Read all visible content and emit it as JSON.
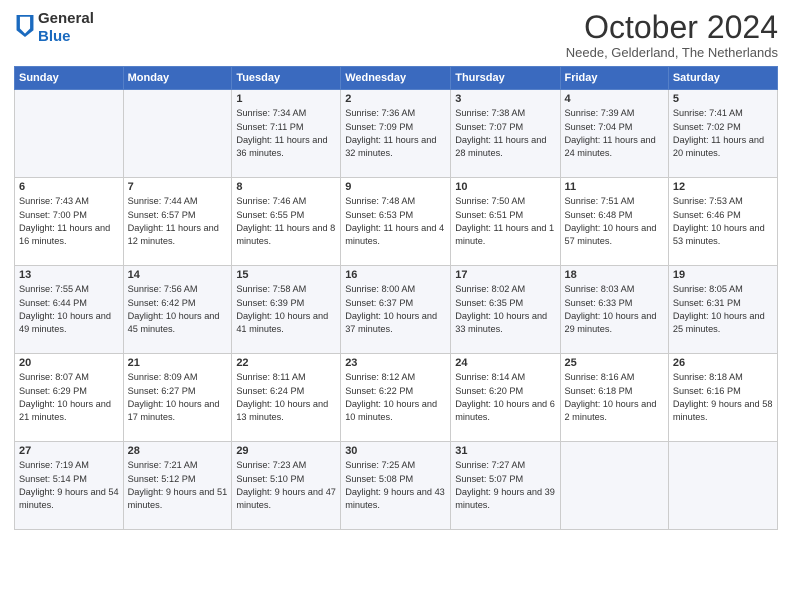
{
  "header": {
    "logo": {
      "line1": "General",
      "line2": "Blue"
    },
    "title": "October 2024",
    "location": "Neede, Gelderland, The Netherlands"
  },
  "weekdays": [
    "Sunday",
    "Monday",
    "Tuesday",
    "Wednesday",
    "Thursday",
    "Friday",
    "Saturday"
  ],
  "weeks": [
    [
      {
        "day": "",
        "sunrise": "",
        "sunset": "",
        "daylight": ""
      },
      {
        "day": "",
        "sunrise": "",
        "sunset": "",
        "daylight": ""
      },
      {
        "day": "1",
        "sunrise": "Sunrise: 7:34 AM",
        "sunset": "Sunset: 7:11 PM",
        "daylight": "Daylight: 11 hours and 36 minutes."
      },
      {
        "day": "2",
        "sunrise": "Sunrise: 7:36 AM",
        "sunset": "Sunset: 7:09 PM",
        "daylight": "Daylight: 11 hours and 32 minutes."
      },
      {
        "day": "3",
        "sunrise": "Sunrise: 7:38 AM",
        "sunset": "Sunset: 7:07 PM",
        "daylight": "Daylight: 11 hours and 28 minutes."
      },
      {
        "day": "4",
        "sunrise": "Sunrise: 7:39 AM",
        "sunset": "Sunset: 7:04 PM",
        "daylight": "Daylight: 11 hours and 24 minutes."
      },
      {
        "day": "5",
        "sunrise": "Sunrise: 7:41 AM",
        "sunset": "Sunset: 7:02 PM",
        "daylight": "Daylight: 11 hours and 20 minutes."
      }
    ],
    [
      {
        "day": "6",
        "sunrise": "Sunrise: 7:43 AM",
        "sunset": "Sunset: 7:00 PM",
        "daylight": "Daylight: 11 hours and 16 minutes."
      },
      {
        "day": "7",
        "sunrise": "Sunrise: 7:44 AM",
        "sunset": "Sunset: 6:57 PM",
        "daylight": "Daylight: 11 hours and 12 minutes."
      },
      {
        "day": "8",
        "sunrise": "Sunrise: 7:46 AM",
        "sunset": "Sunset: 6:55 PM",
        "daylight": "Daylight: 11 hours and 8 minutes."
      },
      {
        "day": "9",
        "sunrise": "Sunrise: 7:48 AM",
        "sunset": "Sunset: 6:53 PM",
        "daylight": "Daylight: 11 hours and 4 minutes."
      },
      {
        "day": "10",
        "sunrise": "Sunrise: 7:50 AM",
        "sunset": "Sunset: 6:51 PM",
        "daylight": "Daylight: 11 hours and 1 minute."
      },
      {
        "day": "11",
        "sunrise": "Sunrise: 7:51 AM",
        "sunset": "Sunset: 6:48 PM",
        "daylight": "Daylight: 10 hours and 57 minutes."
      },
      {
        "day": "12",
        "sunrise": "Sunrise: 7:53 AM",
        "sunset": "Sunset: 6:46 PM",
        "daylight": "Daylight: 10 hours and 53 minutes."
      }
    ],
    [
      {
        "day": "13",
        "sunrise": "Sunrise: 7:55 AM",
        "sunset": "Sunset: 6:44 PM",
        "daylight": "Daylight: 10 hours and 49 minutes."
      },
      {
        "day": "14",
        "sunrise": "Sunrise: 7:56 AM",
        "sunset": "Sunset: 6:42 PM",
        "daylight": "Daylight: 10 hours and 45 minutes."
      },
      {
        "day": "15",
        "sunrise": "Sunrise: 7:58 AM",
        "sunset": "Sunset: 6:39 PM",
        "daylight": "Daylight: 10 hours and 41 minutes."
      },
      {
        "day": "16",
        "sunrise": "Sunrise: 8:00 AM",
        "sunset": "Sunset: 6:37 PM",
        "daylight": "Daylight: 10 hours and 37 minutes."
      },
      {
        "day": "17",
        "sunrise": "Sunrise: 8:02 AM",
        "sunset": "Sunset: 6:35 PM",
        "daylight": "Daylight: 10 hours and 33 minutes."
      },
      {
        "day": "18",
        "sunrise": "Sunrise: 8:03 AM",
        "sunset": "Sunset: 6:33 PM",
        "daylight": "Daylight: 10 hours and 29 minutes."
      },
      {
        "day": "19",
        "sunrise": "Sunrise: 8:05 AM",
        "sunset": "Sunset: 6:31 PM",
        "daylight": "Daylight: 10 hours and 25 minutes."
      }
    ],
    [
      {
        "day": "20",
        "sunrise": "Sunrise: 8:07 AM",
        "sunset": "Sunset: 6:29 PM",
        "daylight": "Daylight: 10 hours and 21 minutes."
      },
      {
        "day": "21",
        "sunrise": "Sunrise: 8:09 AM",
        "sunset": "Sunset: 6:27 PM",
        "daylight": "Daylight: 10 hours and 17 minutes."
      },
      {
        "day": "22",
        "sunrise": "Sunrise: 8:11 AM",
        "sunset": "Sunset: 6:24 PM",
        "daylight": "Daylight: 10 hours and 13 minutes."
      },
      {
        "day": "23",
        "sunrise": "Sunrise: 8:12 AM",
        "sunset": "Sunset: 6:22 PM",
        "daylight": "Daylight: 10 hours and 10 minutes."
      },
      {
        "day": "24",
        "sunrise": "Sunrise: 8:14 AM",
        "sunset": "Sunset: 6:20 PM",
        "daylight": "Daylight: 10 hours and 6 minutes."
      },
      {
        "day": "25",
        "sunrise": "Sunrise: 8:16 AM",
        "sunset": "Sunset: 6:18 PM",
        "daylight": "Daylight: 10 hours and 2 minutes."
      },
      {
        "day": "26",
        "sunrise": "Sunrise: 8:18 AM",
        "sunset": "Sunset: 6:16 PM",
        "daylight": "Daylight: 9 hours and 58 minutes."
      }
    ],
    [
      {
        "day": "27",
        "sunrise": "Sunrise: 7:19 AM",
        "sunset": "Sunset: 5:14 PM",
        "daylight": "Daylight: 9 hours and 54 minutes."
      },
      {
        "day": "28",
        "sunrise": "Sunrise: 7:21 AM",
        "sunset": "Sunset: 5:12 PM",
        "daylight": "Daylight: 9 hours and 51 minutes."
      },
      {
        "day": "29",
        "sunrise": "Sunrise: 7:23 AM",
        "sunset": "Sunset: 5:10 PM",
        "daylight": "Daylight: 9 hours and 47 minutes."
      },
      {
        "day": "30",
        "sunrise": "Sunrise: 7:25 AM",
        "sunset": "Sunset: 5:08 PM",
        "daylight": "Daylight: 9 hours and 43 minutes."
      },
      {
        "day": "31",
        "sunrise": "Sunrise: 7:27 AM",
        "sunset": "Sunset: 5:07 PM",
        "daylight": "Daylight: 9 hours and 39 minutes."
      },
      {
        "day": "",
        "sunrise": "",
        "sunset": "",
        "daylight": ""
      },
      {
        "day": "",
        "sunrise": "",
        "sunset": "",
        "daylight": ""
      }
    ]
  ]
}
